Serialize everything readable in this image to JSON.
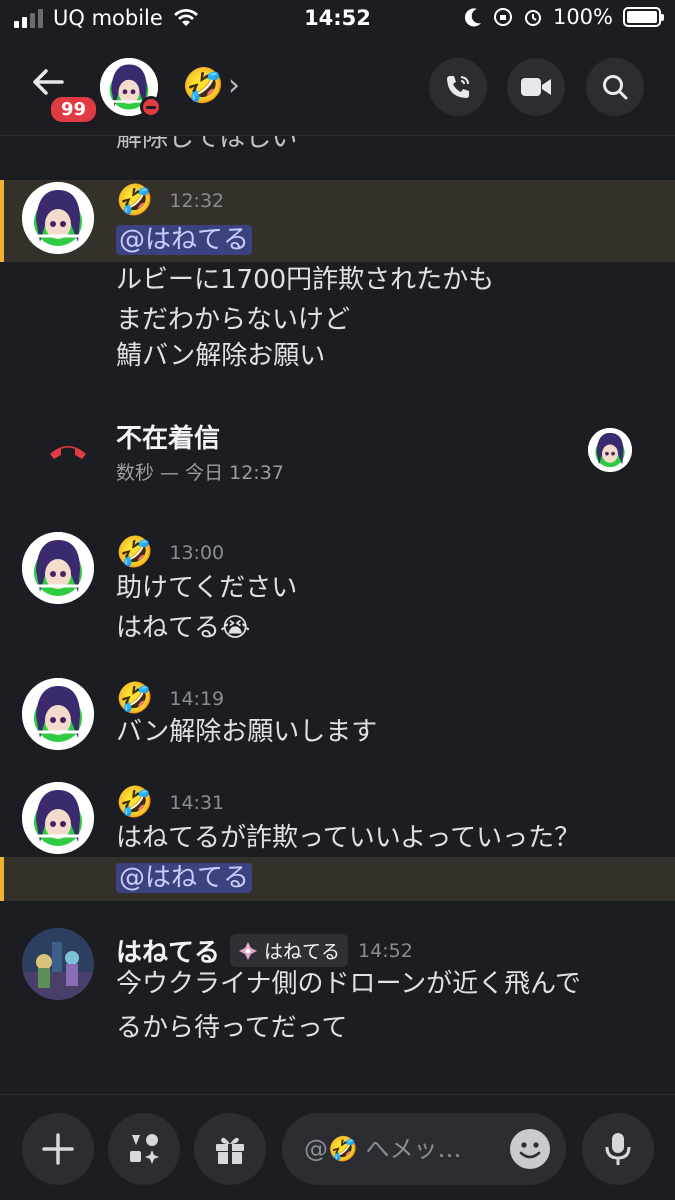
{
  "status_bar": {
    "carrier": "UQ mobile",
    "time": "14:52",
    "battery": "100%"
  },
  "header": {
    "unread_count": "99",
    "channel_name": "🤣",
    "chevron": "›",
    "icons": [
      "phone-icon",
      "video-icon",
      "search-icon"
    ]
  },
  "messages": [
    {
      "author": "🤣",
      "time": "12:32",
      "mention": "@はねてる",
      "lines": [
        "ルビーに1700円詐欺されたかも",
        "まだわからないけど",
        "鯖バン解除お願い"
      ]
    },
    {
      "type": "missed_call",
      "title": "不在着信",
      "subtitle": "数秒 — 今日 12:37"
    },
    {
      "author": "🤣",
      "time": "13:00",
      "lines": [
        "助けてください",
        "はねてる😭"
      ]
    },
    {
      "author": "🤣",
      "time": "14:19",
      "lines": [
        "バン解除お願いします"
      ]
    },
    {
      "author": "🤣",
      "time": "14:31",
      "lines": [
        "はねてるが詐欺っていいよっていった？"
      ],
      "mention": "@はねてる"
    },
    {
      "author": "はねてる",
      "role_tag": "はねてる",
      "time": "14:52",
      "lines": [
        "今ウクライナ側のドローンが近く飛んで",
        "るから待ってだって"
      ]
    }
  ],
  "partial_top_line": "解除してほしい",
  "composer": {
    "placeholder": "@🤣 へメッ…"
  },
  "colors": {
    "background": "#1c1d22",
    "mention_bg": "#3c4280",
    "highlight_bar": "#f0b232",
    "danger": "#e03b42"
  }
}
